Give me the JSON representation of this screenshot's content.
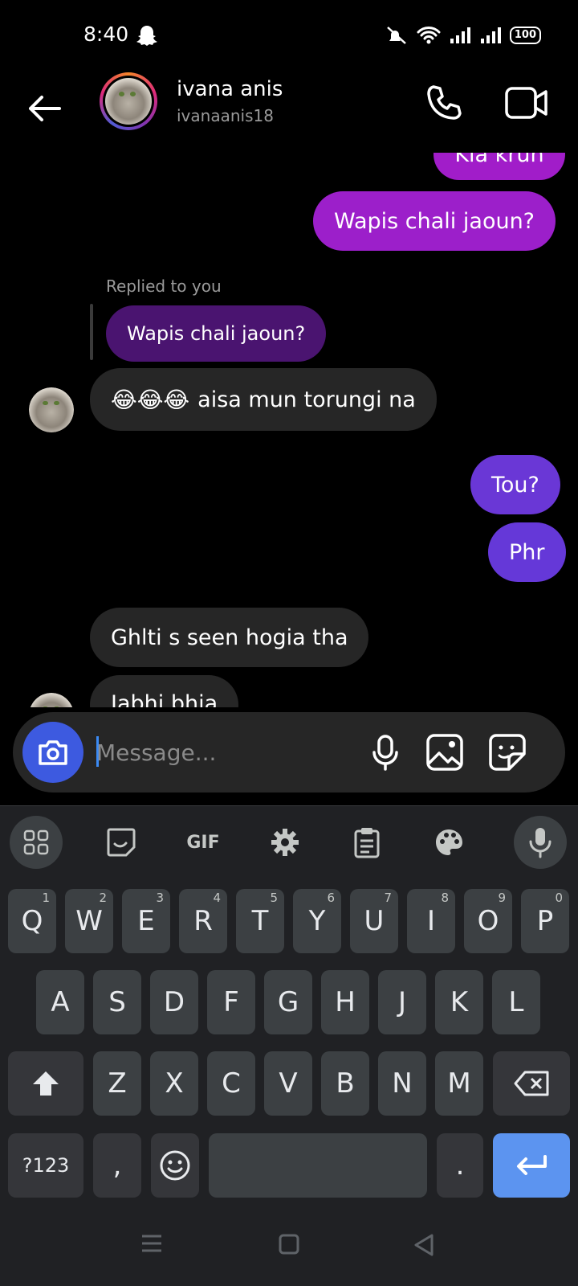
{
  "status_bar": {
    "time": "8:40",
    "battery": "100"
  },
  "header": {
    "name": "ivana anis",
    "username": "ivanaanis18"
  },
  "messages": {
    "out_partial": "Kia krun",
    "out_wapis": "Wapis chali jaoun?",
    "reply_label": "Replied to you",
    "reply_quote": "Wapis chali jaoun?",
    "in_aisa_emoji": "😂😂😂",
    "in_aisa": "aisa mun torungi na",
    "out_tou": "Tou?",
    "out_phr": "Phr",
    "in_ghlti": "Ghlti s seen hogia tha",
    "in_partial": "Jabhi bhia"
  },
  "composer": {
    "placeholder": "Message..."
  },
  "keyboard": {
    "toolbar_gif": "GIF",
    "row1": [
      {
        "k": "Q",
        "h": "1"
      },
      {
        "k": "W",
        "h": "2"
      },
      {
        "k": "E",
        "h": "3"
      },
      {
        "k": "R",
        "h": "4"
      },
      {
        "k": "T",
        "h": "5"
      },
      {
        "k": "Y",
        "h": "6"
      },
      {
        "k": "U",
        "h": "7"
      },
      {
        "k": "I",
        "h": "8"
      },
      {
        "k": "O",
        "h": "9"
      },
      {
        "k": "P",
        "h": "0"
      }
    ],
    "row2": [
      "A",
      "S",
      "D",
      "F",
      "G",
      "H",
      "J",
      "K",
      "L"
    ],
    "row3": [
      "Z",
      "X",
      "C",
      "V",
      "B",
      "N",
      "M"
    ],
    "symbols": "?123",
    "comma": ",",
    "period": "."
  },
  "colors": {
    "outgoing_pink": "#a11dc9",
    "outgoing_purple": "#6a37d6",
    "incoming": "#262626",
    "camera_button": "#3d5ae0",
    "enter_key": "#5c94f0"
  }
}
